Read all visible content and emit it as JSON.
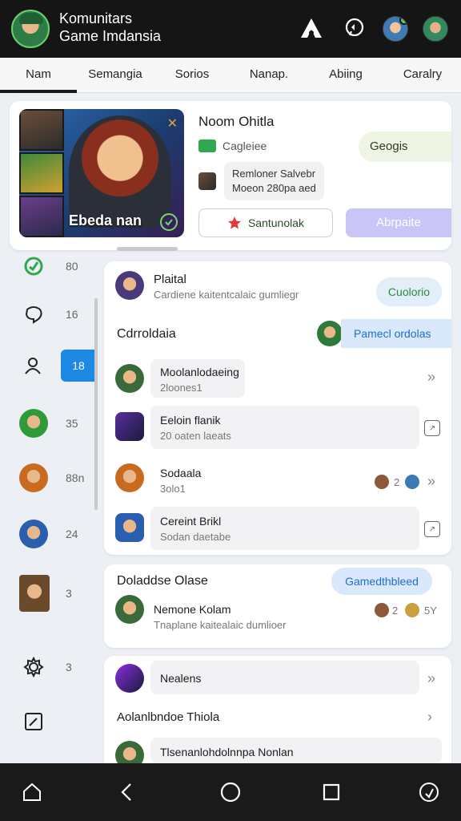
{
  "header": {
    "title_line1": "Komunitars",
    "title_line2": "Game Imdansia",
    "icons": [
      "profile-avatar",
      "triangle-logo-icon",
      "chat-bubble-icon",
      "friend-avatar",
      "friend-avatar"
    ]
  },
  "tabs": [
    "Nam",
    "Semangia",
    "Sorios",
    "Nanap.",
    "Abiing",
    "Caralry"
  ],
  "profile": {
    "banner_caption": "Ebeda nan",
    "name": "Noom Ohitla",
    "status": "Cagleiee",
    "pill": "Geogis",
    "detail_line1": "Remloner Salvebr",
    "detail_line2": "Moeon 280pa aed",
    "button_outline": "Santunolak",
    "button_purple": "Abrpaite"
  },
  "rail": [
    {
      "icon": "check-circle-icon",
      "count": "80"
    },
    {
      "icon": "chat-icon",
      "count": "16"
    },
    {
      "icon": "user-icon",
      "count": "18",
      "active": true
    },
    {
      "icon": "game-avatar",
      "count": "35"
    },
    {
      "icon": "game-avatar",
      "count": "88n"
    },
    {
      "icon": "game-avatar",
      "count": "24"
    },
    {
      "icon": "game-avatar",
      "count": "3"
    },
    {
      "icon": "gear-icon",
      "count": "3"
    },
    {
      "icon": "edit-icon",
      "count": ""
    }
  ],
  "list": {
    "top_name": "Plaital",
    "top_sub": "Cardiene kaitentcalaic gumliegr",
    "top_chip": "Cuolorio",
    "section": "Cdrroldaia",
    "section_chip": "Pamecl ordolas",
    "rows": [
      {
        "title": "Moolanlodaeing",
        "sub": "2loones1"
      },
      {
        "title": "Eeloin flanik",
        "sub": "20 oaten laeats"
      },
      {
        "title": "Sodaala",
        "sub": "3olo1",
        "count": "2"
      },
      {
        "title": "Cereint Brikl",
        "sub": "Sodan daetabe"
      }
    ]
  },
  "card2": {
    "title": "Doladdse Olase",
    "chip": "Gamedthbleed",
    "name": "Nemone Kolam",
    "sub": "Tnaplane kaitealaic dumlioer",
    "count": "2",
    "extra": "5Y"
  },
  "card3": {
    "row1": "Nealens",
    "row2": "Aolanlbndoe Thiola",
    "row3": "Tlsenanlohdolnnpa Nonlan"
  },
  "colors": {
    "accent_blue": "#1e88e5",
    "accent_purple": "#c9c6f7",
    "header_bg": "#151515",
    "online_green": "#5cc95c"
  }
}
